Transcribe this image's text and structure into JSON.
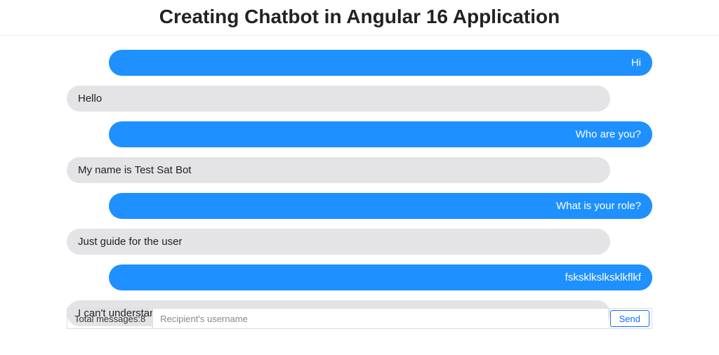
{
  "header": {
    "title": "Creating Chatbot in Angular 16 Application"
  },
  "messages": [
    {
      "role": "user",
      "text": "Hi"
    },
    {
      "role": "bot",
      "text": "Hello"
    },
    {
      "role": "user",
      "text": "Who are you?"
    },
    {
      "role": "bot",
      "text": "My name is Test Sat Bot"
    },
    {
      "role": "user",
      "text": "What is your role?"
    },
    {
      "role": "bot",
      "text": "Just guide for the user"
    },
    {
      "role": "user",
      "text": "fsksklkslksklkflkf"
    },
    {
      "role": "bot",
      "text": "I can't understand your text. Can you please repeat"
    }
  ],
  "footer": {
    "total_label_prefix": "Total messages: ",
    "total_count": 8,
    "input_placeholder": "Recipient's username",
    "send_label": "Send"
  }
}
